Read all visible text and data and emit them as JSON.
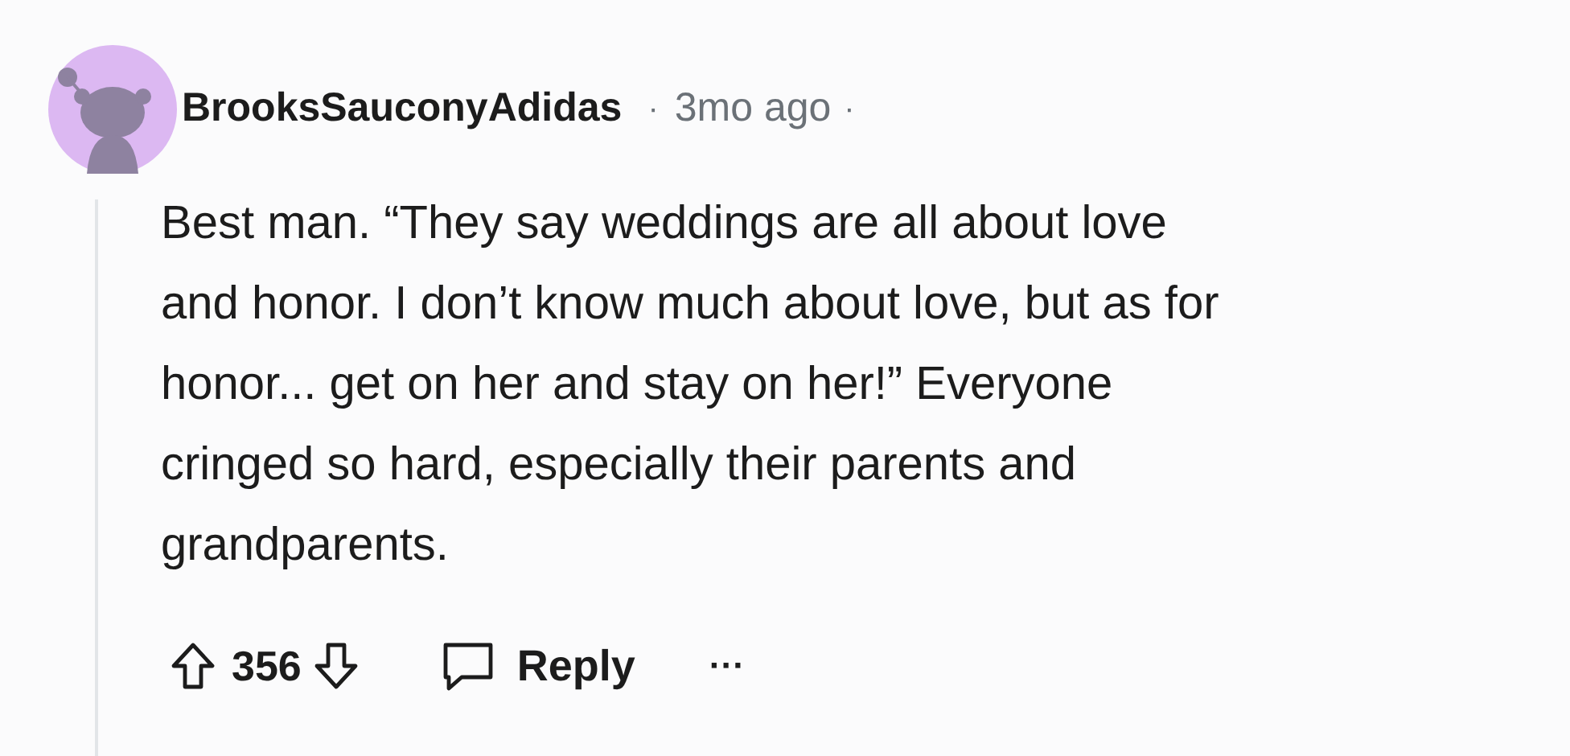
{
  "comment": {
    "author": "BrooksSauconyAdidas",
    "separator_before": "·",
    "time": "3mo ago",
    "separator_after": "·",
    "body_lines": [
      "Best man. “They say weddings are all about love",
      "and honor. I don’t know much about love, but as for",
      "honor... get on her and stay on her!” Everyone",
      "cringed so hard, especially their parents and",
      "grandparents."
    ],
    "score": "356",
    "reply_label": "Reply",
    "more_label": "···"
  }
}
